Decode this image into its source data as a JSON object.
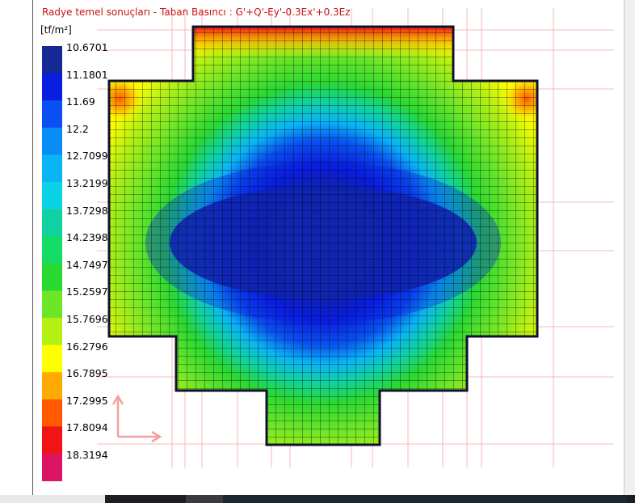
{
  "view": {
    "title": "Radye temel sonuçları - Taban Basıncı : G'+Q'-Ey'-0.3Ex'+0.3Ez",
    "unit": "[tf/m²]"
  },
  "legend": {
    "entries": [
      {
        "value": "10.6701",
        "color": "#142896"
      },
      {
        "value": "11.1801",
        "color": "#0a1ee0"
      },
      {
        "value": "11.69",
        "color": "#0a50f0"
      },
      {
        "value": "12.2",
        "color": "#0a8cf5"
      },
      {
        "value": "12.7099",
        "color": "#0ab4f5"
      },
      {
        "value": "13.2199",
        "color": "#0ad2e6"
      },
      {
        "value": "13.7298",
        "color": "#10d2a0"
      },
      {
        "value": "14.2398",
        "color": "#14dc64"
      },
      {
        "value": "14.7497",
        "color": "#2ad832"
      },
      {
        "value": "15.2597",
        "color": "#6ee628"
      },
      {
        "value": "15.7696",
        "color": "#b4f014"
      },
      {
        "value": "16.2796",
        "color": "#ffff00"
      },
      {
        "value": "16.7895",
        "color": "#ffaa00"
      },
      {
        "value": "17.2995",
        "color": "#ff5a00"
      },
      {
        "value": "17.8094",
        "color": "#f01414"
      },
      {
        "value": "18.3194",
        "color": "#dc1464"
      }
    ]
  },
  "axes_icon": {
    "color": "#f4a0a0"
  }
}
